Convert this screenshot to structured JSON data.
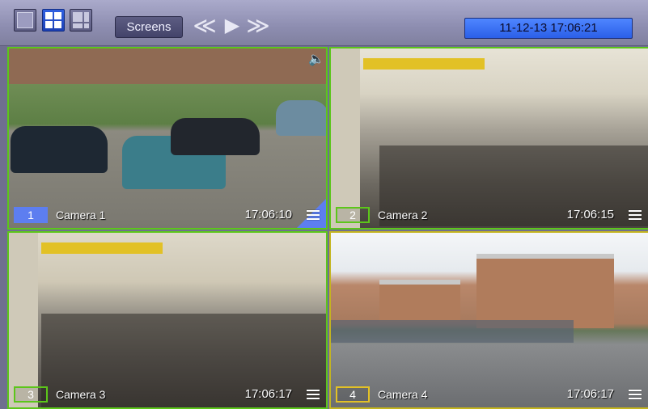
{
  "toolbar": {
    "screens_label": "Screens",
    "nav_prev_icon": "double-left-chevron-icon",
    "nav_play_icon": "play-icon",
    "nav_next_icon": "double-right-chevron-icon",
    "datetime": "11-12-13  17:06:21"
  },
  "colors": {
    "active_border": "#5cc61a",
    "selected_border": "#c4b51f",
    "accent_blue": "#2b5fe8"
  },
  "cameras": [
    {
      "number": "1",
      "name": "Camera 1",
      "time": "17:06:10"
    },
    {
      "number": "2",
      "name": "Camera 2",
      "time": "17:06:15"
    },
    {
      "number": "3",
      "name": "Camera 3",
      "time": "17:06:17"
    },
    {
      "number": "4",
      "name": "Camera 4",
      "time": "17:06:17"
    }
  ]
}
